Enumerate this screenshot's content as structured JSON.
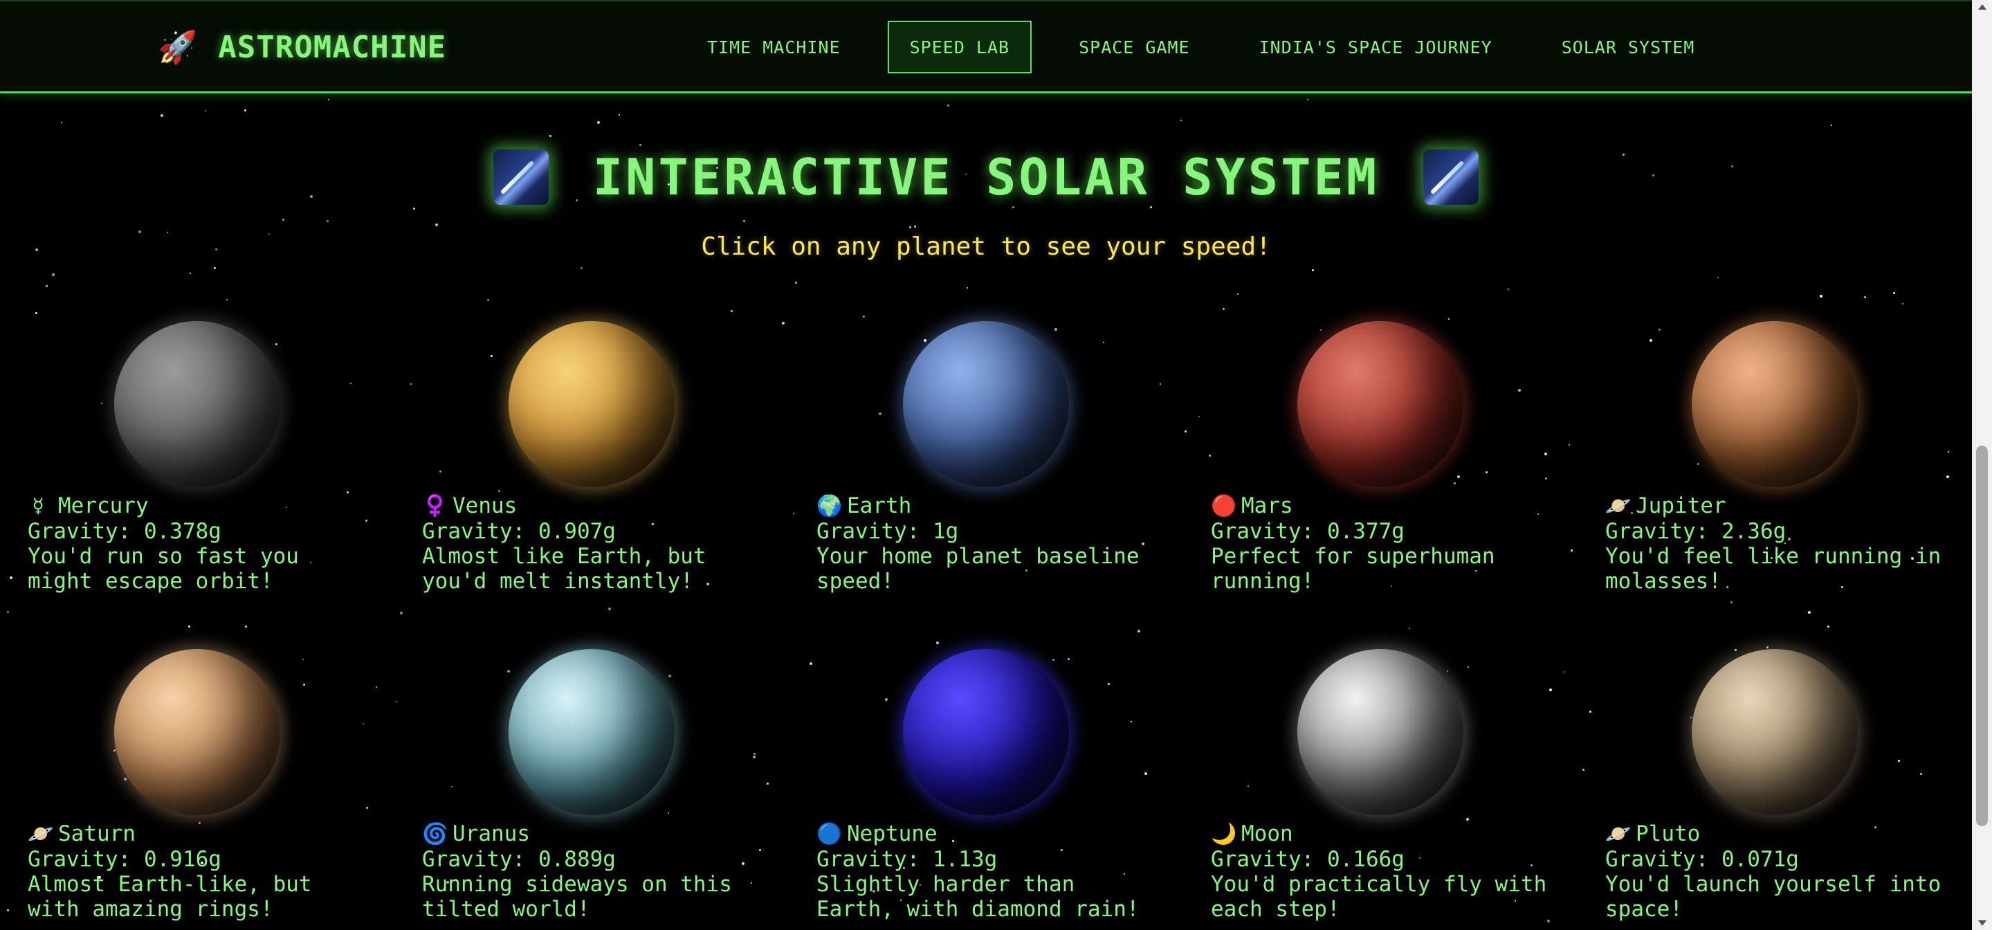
{
  "brand": {
    "icon": "rocket-icon",
    "icon_glyph": "🚀",
    "name": "ASTROMACHINE"
  },
  "nav": [
    {
      "label": "TIME MACHINE",
      "active": false
    },
    {
      "label": "SPEED LAB",
      "active": true
    },
    {
      "label": "SPACE GAME",
      "active": false
    },
    {
      "label": "INDIA'S SPACE JOURNEY",
      "active": false
    },
    {
      "label": "SOLAR SYSTEM",
      "active": false
    }
  ],
  "page": {
    "title": "INTERACTIVE SOLAR SYSTEM",
    "title_icon": "milky-way-icon",
    "subtitle": "Click on any planet to see your speed!"
  },
  "planets": [
    {
      "id": "mercury",
      "emoji": "☿",
      "name": "Mercury",
      "gravity": "Gravity: 0.378g",
      "description": "You'd run so fast you might escape orbit!",
      "colors": [
        "#9a9a9a",
        "#5e5e5e"
      ],
      "glow": "rgba(200,200,200,0.25)"
    },
    {
      "id": "venus",
      "emoji": "♀️",
      "name": "Venus",
      "gravity": "Gravity: 0.907g",
      "description": "Almost like Earth, but you'd melt instantly!",
      "colors": [
        "#f6d27a",
        "#c98a2c"
      ],
      "glow": "rgba(240,190,90,0.45)"
    },
    {
      "id": "earth",
      "emoji": "🌍",
      "name": "Earth",
      "gravity": "Gravity: 1g",
      "description": "Your home planet baseline speed!",
      "colors": [
        "#8fb0ea",
        "#3c5a9a"
      ],
      "glow": "rgba(110,150,230,0.45)"
    },
    {
      "id": "mars",
      "emoji": "🔴",
      "name": "Mars",
      "gravity": "Gravity: 0.377g",
      "description": "Perfect for superhuman running!",
      "colors": [
        "#e07a6a",
        "#9a2a22"
      ],
      "glow": "rgba(200,70,60,0.45)"
    },
    {
      "id": "jupiter",
      "emoji": "🪐",
      "name": "Jupiter",
      "gravity": "Gravity: 2.36g",
      "description": "You'd feel like running in molasses!",
      "colors": [
        "#f0b08a",
        "#9a5a2a"
      ],
      "glow": "rgba(220,130,70,0.45)"
    },
    {
      "id": "saturn",
      "emoji": "🪐",
      "name": "Saturn",
      "gravity": "Gravity: 0.916g",
      "description": "Almost Earth-like, but with amazing rings!",
      "colors": [
        "#f6d2a8",
        "#b57a4a"
      ],
      "glow": "rgba(240,190,140,0.4)"
    },
    {
      "id": "uranus",
      "emoji": "🌀",
      "name": "Uranus",
      "gravity": "Gravity: 0.889g",
      "description": "Running sideways on this tilted world!",
      "colors": [
        "#d8f2f6",
        "#5a9aa6"
      ],
      "glow": "rgba(150,220,230,0.45)"
    },
    {
      "id": "neptune",
      "emoji": "🔵",
      "name": "Neptune",
      "gravity": "Gravity: 1.13g",
      "description": "Slightly harder than Earth, with diamond rain!",
      "colors": [
        "#5a4aff",
        "#1a12a0"
      ],
      "glow": "rgba(60,60,255,0.55)"
    },
    {
      "id": "moon",
      "emoji": "🌙",
      "name": "Moon",
      "gravity": "Gravity: 0.166g",
      "description": "You'd practically fly with each step!",
      "colors": [
        "#f2f2f2",
        "#7a7a7a"
      ],
      "glow": "rgba(230,230,230,0.35)"
    },
    {
      "id": "pluto",
      "emoji": "🪐",
      "name": "Pluto",
      "gravity": "Gravity: 0.071g",
      "description": "You'd launch yourself into space!",
      "colors": [
        "#e8d6b8",
        "#8f7a5a"
      ],
      "glow": "rgba(220,200,160,0.35)"
    }
  ]
}
